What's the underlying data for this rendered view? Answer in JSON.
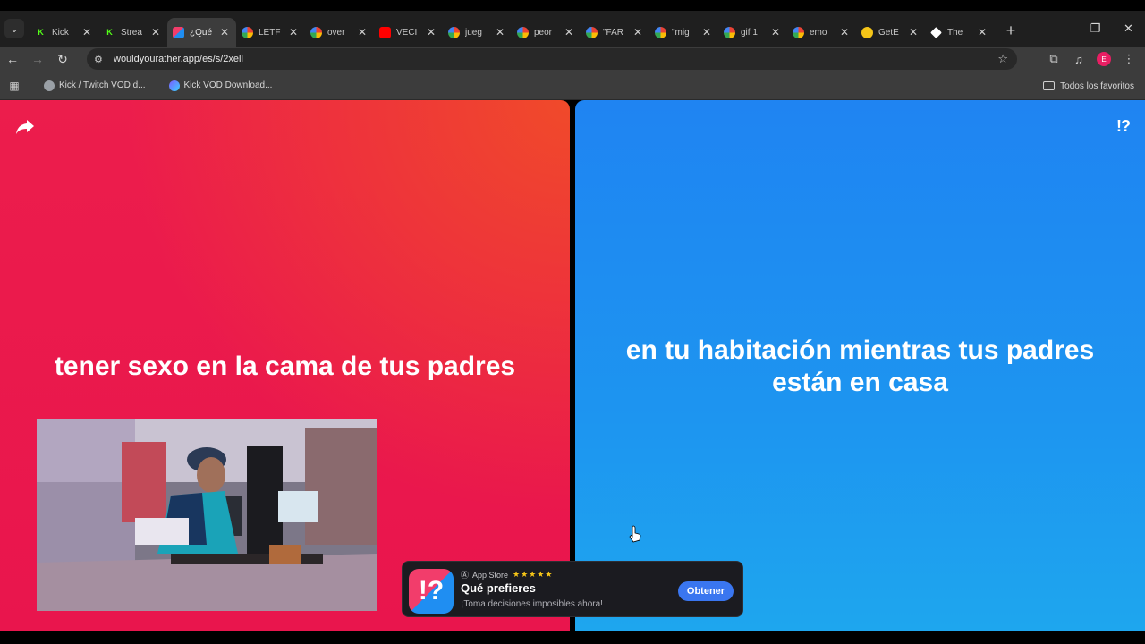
{
  "browser": {
    "tabs": [
      {
        "title": "Kick",
        "favicon": "kick-icon",
        "color": "#53fc18",
        "active": false
      },
      {
        "title": "Strea",
        "favicon": "kick-icon",
        "color": "#53fc18",
        "active": false
      },
      {
        "title": "¿Qué",
        "favicon": "wyr-icon",
        "color": "#e91e63",
        "active": true
      },
      {
        "title": "LETF",
        "favicon": "google-icon",
        "color": "#ffffff",
        "active": false
      },
      {
        "title": "over",
        "favicon": "google-icon",
        "color": "#ffffff",
        "active": false
      },
      {
        "title": "VECI",
        "favicon": "youtube-icon",
        "color": "#ff0000",
        "active": false
      },
      {
        "title": "jueg",
        "favicon": "google-icon",
        "color": "#ffffff",
        "active": false
      },
      {
        "title": "peor",
        "favicon": "google-icon",
        "color": "#ffffff",
        "active": false
      },
      {
        "title": "\"FAR",
        "favicon": "google-icon",
        "color": "#ffffff",
        "active": false
      },
      {
        "title": "\"mig",
        "favicon": "google-icon",
        "color": "#ffffff",
        "active": false
      },
      {
        "title": "gif 1",
        "favicon": "google-icon",
        "color": "#ffffff",
        "active": false
      },
      {
        "title": "emo",
        "favicon": "google-icon",
        "color": "#ffffff",
        "active": false
      },
      {
        "title": "GetE",
        "favicon": "emoji-icon",
        "color": "#f5c518",
        "active": false
      },
      {
        "title": "The",
        "favicon": "diamond-icon",
        "color": "#ffffff",
        "active": false
      }
    ],
    "url": "wouldyourather.app/es/s/2xell",
    "profile_initial": "E",
    "bookmarks": [
      {
        "label": "Kick / Twitch VOD d...",
        "icon": "globe-icon"
      },
      {
        "label": "Kick VOD Download...",
        "icon": "vod-icon"
      }
    ],
    "all_bookmarks_label": "Todos los favoritos"
  },
  "game": {
    "option_left": "tener sexo en la cama de tus padres",
    "option_right_line1": "en tu habitación mientras tus padres",
    "option_right_line2": "están en casa",
    "logo": "!?",
    "left_color": "#ec1d4c",
    "right_color": "#1f8ef2"
  },
  "banner": {
    "store_label": "App Store",
    "stars": "★★★★★",
    "app_name": "Qué prefieres",
    "tagline": "¡Toma decisiones imposibles ahora!",
    "cta": "Obtener",
    "icon_glyph": "!?"
  }
}
